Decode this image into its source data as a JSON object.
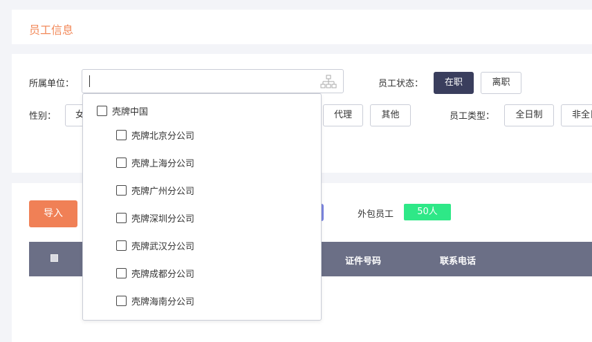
{
  "header": {
    "title": "员工信息"
  },
  "filters": {
    "unit_label": "所属单位：",
    "unit_value": "",
    "status_label": "员工状态：",
    "status_options": [
      "在职",
      "离职"
    ],
    "status_selected": "在职",
    "gender_label": "性别：",
    "gender_partial": "女",
    "type_options_row": [
      "代理",
      "其他"
    ],
    "employee_type_label": "员工类型：",
    "employee_type_options": [
      "全日制",
      "非全日"
    ]
  },
  "toolbar": {
    "import_label": "导入",
    "outsourced_label": "外包员工",
    "outsourced_count": "50人"
  },
  "table": {
    "columns": [
      "证件号码",
      "联系电话"
    ]
  },
  "unit_tree": {
    "root": "壳牌中国",
    "children": [
      "壳牌北京分公司",
      "壳牌上海分公司",
      "壳牌广州分公司",
      "壳牌深圳分公司",
      "壳牌武汉分公司",
      "壳牌成都分公司",
      "壳牌海南分公司"
    ]
  },
  "icons": {
    "tree": "org-tree-icon"
  },
  "colors": {
    "accent": "#f28858",
    "active_button": "#3a3e5d",
    "badge": "#2ee887",
    "table_header": "#6b6f86"
  }
}
